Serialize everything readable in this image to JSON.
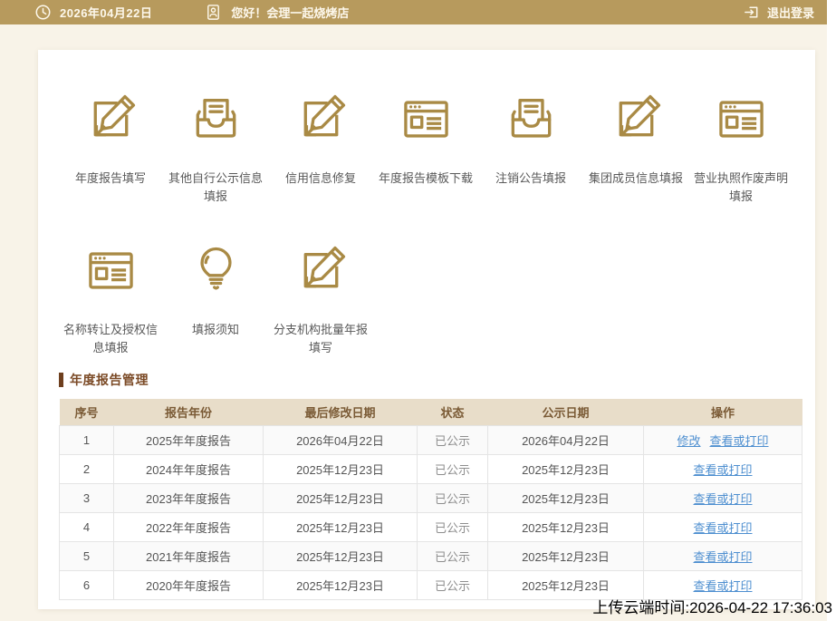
{
  "topbar": {
    "date": "2026年04月22日",
    "greeting": "您好！会理一起烧烤店",
    "logout": "退出登录"
  },
  "shortcuts": [
    {
      "label": "年度报告填写",
      "icon": "edit-square-icon"
    },
    {
      "label": "其他自行公示信息填报",
      "icon": "inbox-icon"
    },
    {
      "label": "信用信息修复",
      "icon": "edit-square-icon"
    },
    {
      "label": "年度报告模板下载",
      "icon": "browser-icon"
    },
    {
      "label": "注销公告填报",
      "icon": "inbox-icon"
    },
    {
      "label": "集团成员信息填报",
      "icon": "edit-square-icon"
    },
    {
      "label": "营业执照作废声明填报",
      "icon": "browser-icon"
    },
    {
      "label": "名称转让及授权信息填报",
      "icon": "browser-icon"
    },
    {
      "label": "填报须知",
      "icon": "bulb-icon"
    },
    {
      "label": "分支机构批量年报填写",
      "icon": "edit-square-icon"
    }
  ],
  "annual_report": {
    "title": "年度报告管理",
    "columns": [
      "序号",
      "报告年份",
      "最后修改日期",
      "状态",
      "公示日期",
      "操作"
    ],
    "rows": [
      {
        "no": "1",
        "year": "2025年年度报告",
        "modified": "2026年04月22日",
        "status": "已公示",
        "published": "2026年04月22日",
        "actions": [
          "修改",
          "查看或打印"
        ]
      },
      {
        "no": "2",
        "year": "2024年年度报告",
        "modified": "2025年12月23日",
        "status": "已公示",
        "published": "2025年12月23日",
        "actions": [
          "查看或打印"
        ]
      },
      {
        "no": "3",
        "year": "2023年年度报告",
        "modified": "2025年12月23日",
        "status": "已公示",
        "published": "2025年12月23日",
        "actions": [
          "查看或打印"
        ]
      },
      {
        "no": "4",
        "year": "2022年年度报告",
        "modified": "2025年12月23日",
        "status": "已公示",
        "published": "2025年12月23日",
        "actions": [
          "查看或打印"
        ]
      },
      {
        "no": "5",
        "year": "2021年年度报告",
        "modified": "2025年12月23日",
        "status": "已公示",
        "published": "2025年12月23日",
        "actions": [
          "查看或打印"
        ]
      },
      {
        "no": "6",
        "year": "2020年年度报告",
        "modified": "2025年12月23日",
        "status": "已公示",
        "published": "2025年12月23日",
        "actions": [
          "查看或打印"
        ]
      }
    ]
  },
  "overlay": {
    "upload_time": "上传云端时间:2026-04-22 17:36:03"
  },
  "colors": {
    "topbar_bg": "#b79a5d",
    "page_bg": "#f8f3e8",
    "icon_gold": "#a98a45",
    "table_header_bg": "#e8ddc9",
    "table_header_text": "#7a5a35",
    "section_accent": "#6e3f1e",
    "link_blue": "#4e8fd0",
    "status_gray": "#8e8e8e"
  }
}
